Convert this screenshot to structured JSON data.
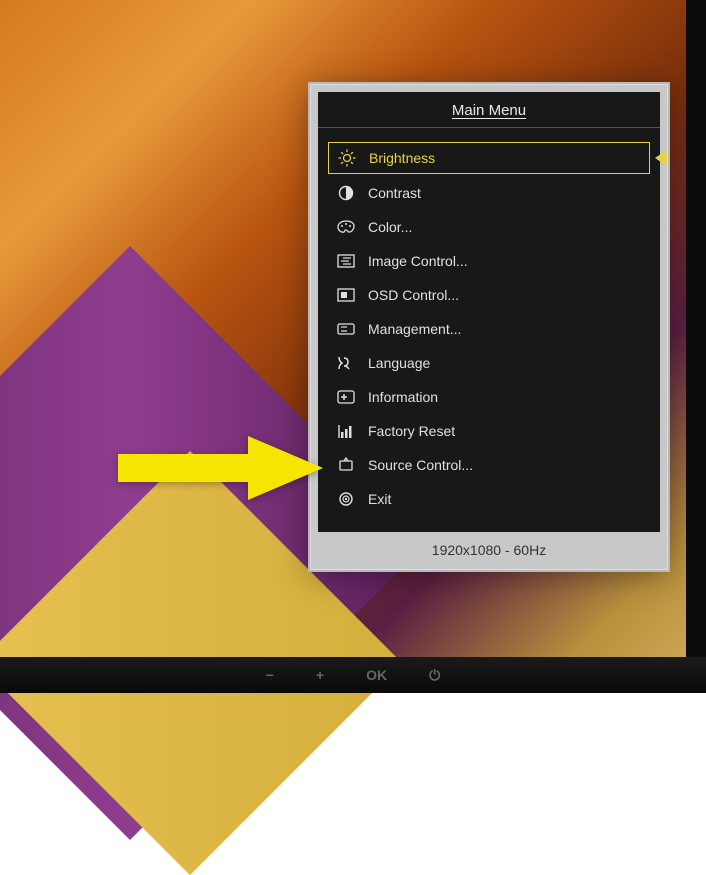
{
  "osd": {
    "title": "Main Menu",
    "footer": "1920x1080 - 60Hz",
    "items": {
      "brightness": "Brightness",
      "contrast": "Contrast",
      "color": "Color...",
      "image_control": "Image Control...",
      "osd_control": "OSD Control...",
      "management": "Management...",
      "language": "Language",
      "information": "Information",
      "factory_reset": "Factory Reset",
      "source_control": "Source Control...",
      "exit": "Exit"
    }
  },
  "bezel": {
    "minus": "−",
    "plus": "+",
    "ok": "OK",
    "power": "⏻"
  }
}
